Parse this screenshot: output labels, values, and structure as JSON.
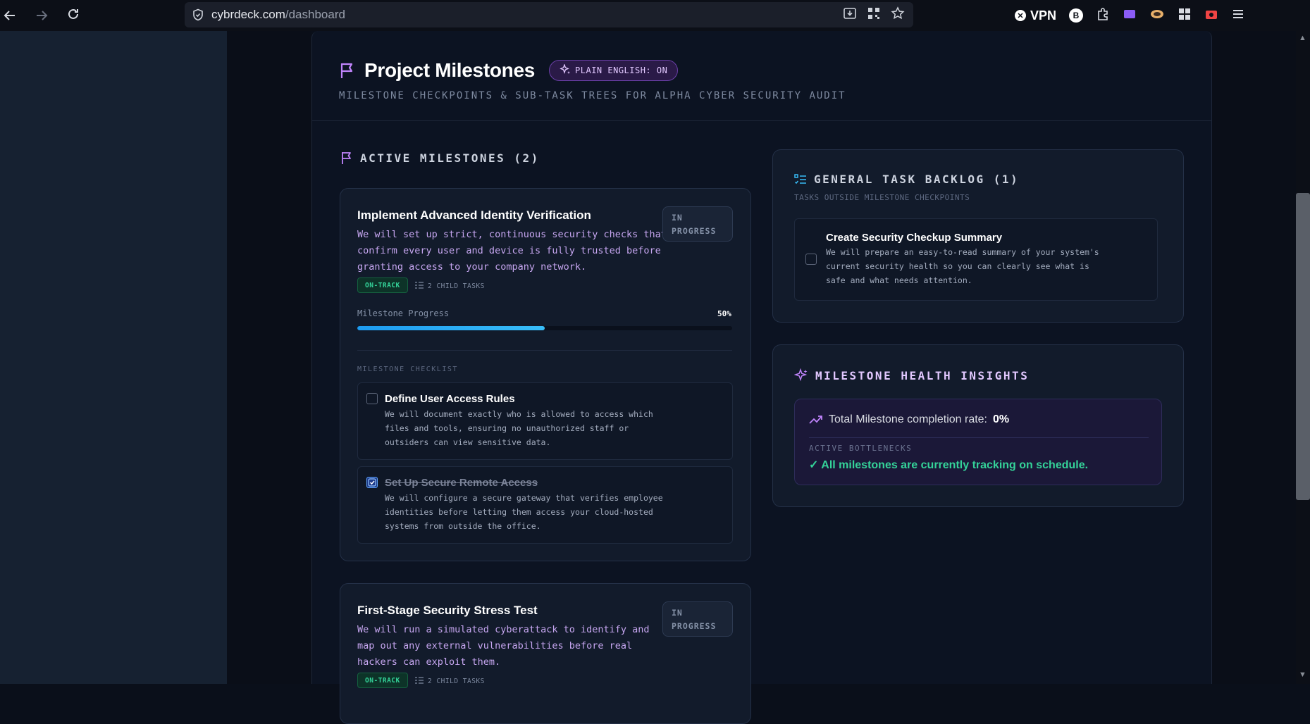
{
  "browser": {
    "url_host": "cybrdeck.com",
    "url_path": "/dashboard",
    "vpn_label": "VPN",
    "ext_b_label": "B"
  },
  "header": {
    "title": "Project Milestones",
    "plain_english_badge": "PLAIN ENGLISH: ON",
    "subtitle": "MILESTONE CHECKPOINTS & SUB-TASK TREES FOR ALPHA CYBER SECURITY AUDIT"
  },
  "active_milestones": {
    "heading": "ACTIVE MILESTONES (2)",
    "items": [
      {
        "title": "Implement Advanced Identity Verification",
        "description_lines": [
          "We will set up strict, continuous security checks that",
          "confirm every user and device is fully trusted before",
          "granting access to your company network."
        ],
        "status_lines": [
          "IN",
          "PROGRESS"
        ],
        "health_badge": "ON-TRACK",
        "child_tasks": "2 CHILD TASKS",
        "progress_label": "Milestone Progress",
        "progress_value": "50%",
        "progress": 0.5,
        "checklist_label": "MILESTONE CHECKLIST",
        "checklist": [
          {
            "title": "Define User Access Rules",
            "checked": false,
            "description_lines": [
              "We will document exactly who is allowed to access which",
              "files and tools, ensuring no unauthorized staff or",
              "outsiders can view sensitive data."
            ]
          },
          {
            "title": "Set Up Secure Remote Access",
            "checked": true,
            "description_lines": [
              "We will configure a secure gateway that verifies employee",
              "identities before letting them access your cloud-hosted",
              "systems from outside the office."
            ]
          }
        ]
      },
      {
        "title": "First-Stage Security Stress Test",
        "description_lines": [
          "We will run a simulated cyberattack to identify and",
          "map out any external vulnerabilities before real",
          "hackers can exploit them."
        ],
        "status_lines": [
          "IN",
          "PROGRESS"
        ],
        "health_badge": "ON-TRACK",
        "child_tasks": "2 CHILD TASKS"
      }
    ]
  },
  "backlog": {
    "heading": "GENERAL TASK BACKLOG (1)",
    "subheading": "TASKS OUTSIDE MILESTONE CHECKPOINTS",
    "task": {
      "title": "Create Security Checkup Summary",
      "checked": false,
      "description_lines": [
        "We will prepare an easy-to-read summary of your system's",
        "current security health so you can clearly see what is",
        "safe and what needs attention."
      ]
    }
  },
  "insights": {
    "heading": "MILESTONE HEALTH INSIGHTS",
    "rate_label": "Total Milestone completion rate:",
    "rate_value": "0%",
    "bottlenecks_label": "ACTIVE BOTTLENECKS",
    "bottlenecks_value": "✓ All milestones are currently tracking on schedule."
  },
  "colors": {
    "accent_purple": "#c084fc",
    "accent_green": "#34d399",
    "accent_blue": "#38bdf8"
  }
}
